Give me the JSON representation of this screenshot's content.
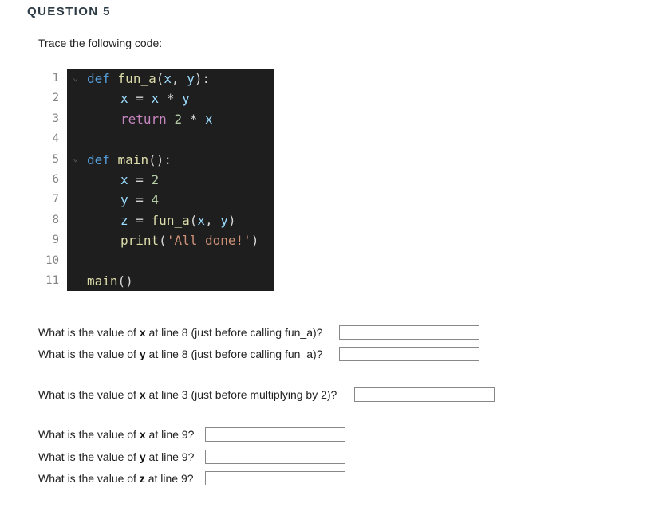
{
  "question_title": "QUESTION 5",
  "prompt": "Trace the following code:",
  "code_lines": [
    {
      "num": "1",
      "text": "def fun_a(x, y):"
    },
    {
      "num": "2",
      "text": "x = x * y"
    },
    {
      "num": "3",
      "text": "return 2 * x"
    },
    {
      "num": "4",
      "text": ""
    },
    {
      "num": "5",
      "text": "def main():"
    },
    {
      "num": "6",
      "text": "x = 2"
    },
    {
      "num": "7",
      "text": "y = 4"
    },
    {
      "num": "8",
      "text": "z = fun_a(x, y)"
    },
    {
      "num": "9",
      "text": "print('All done!')"
    },
    {
      "num": "10",
      "text": ""
    },
    {
      "num": "11",
      "text": "main()"
    }
  ],
  "questions": [
    {
      "pre": "What is the value of ",
      "var": "x",
      "post": " at line 8 (just before calling fun_a)?",
      "value": ""
    },
    {
      "pre": "What is the value of ",
      "var": "y",
      "post": " at line 8 (just before calling fun_a)?",
      "value": ""
    },
    {
      "pre": "What is the value of ",
      "var": "x",
      "post": " at line 3 (just before multiplying by 2)?",
      "value": ""
    },
    {
      "pre": "What is the value of ",
      "var": "x",
      "post": " at line 9?",
      "value": ""
    },
    {
      "pre": "What is the value of ",
      "var": "y",
      "post": " at line 9?",
      "value": ""
    },
    {
      "pre": "What is the value of ",
      "var": "z",
      "post": " at line 9?",
      "value": ""
    }
  ]
}
